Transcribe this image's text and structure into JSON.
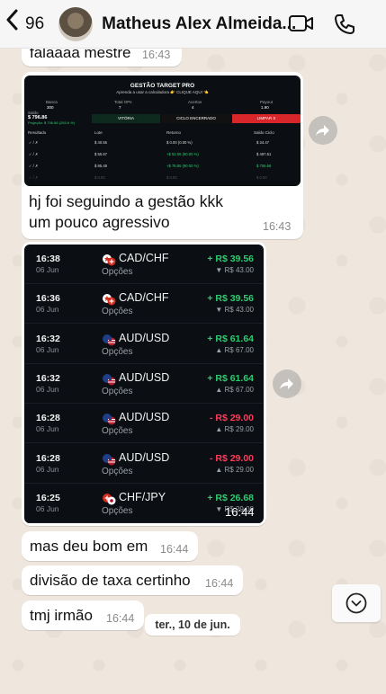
{
  "header": {
    "back_count": "96",
    "contact_name": "Matheus Alex Almeida..."
  },
  "messages": [
    {
      "text": "falaaaa mestre",
      "time": "16:43"
    },
    {
      "caption_line1": "hj foi seguindo a gestão kkk",
      "caption_line2": "um pouco agressivo",
      "time": "16:43"
    },
    {
      "time": "16:44"
    },
    {
      "text": "mas deu bom em",
      "time": "16:44"
    },
    {
      "text": "divisão de taxa certinho",
      "time": "16:44"
    },
    {
      "text": "tmj irmão",
      "time": "16:44"
    }
  ],
  "gestao": {
    "title": "GESTÃO TARGET PRO",
    "subtitle": "Aprenda a usar a calculadora 👉 CLIQUE AQUI 👈",
    "stats_labels": [
      "Banca",
      "Total OPs",
      "Acertos",
      "Payout"
    ],
    "stats_values": [
      "300",
      "7",
      "4",
      "1.90"
    ],
    "balance_label": "Saldo",
    "balance_value": "$ 796.86",
    "projected": "Projeção: $ 796.86 (265.6 %)",
    "tabs": [
      "VITÓRIA",
      "CICLO ENCERRADO",
      "LIMPAR X"
    ],
    "columns": [
      "Resultado",
      "Lote",
      "Retorno",
      "Saldo Ciclo"
    ],
    "rows": [
      [
        "✓ / ✗",
        "$ 40.55",
        "$ 0.00 (0.00 %)",
        "$ 34.47"
      ],
      [
        "✓ / ✗",
        "$ 55.67",
        "+$ 52.06 (90.00 %)",
        "$ 497.61"
      ],
      [
        "✓ / ✗",
        "$ 85.48",
        "+$ 78.85 (90.00 %)",
        "$ 756.66"
      ],
      [
        "✓ / ✗",
        "$ 0.00",
        "$ 0.00",
        "$ 0.00"
      ]
    ]
  },
  "trades": [
    {
      "time": "16:38",
      "date": "06 Jun",
      "pair": "CAD/CHF",
      "type": "Opções",
      "amount": "+ R$ 39.56",
      "stake": "▼ R$ 43.00",
      "color": "#2ecc71",
      "flag": "ca-ch"
    },
    {
      "time": "16:36",
      "date": "06 Jun",
      "pair": "CAD/CHF",
      "type": "Opções",
      "amount": "+ R$ 39.56",
      "stake": "▼ R$ 43.00",
      "color": "#2ecc71",
      "flag": "ca-ch"
    },
    {
      "time": "16:32",
      "date": "06 Jun",
      "pair": "AUD/USD",
      "type": "Opções",
      "amount": "+ R$ 61.64",
      "stake": "▲ R$ 67.00",
      "color": "#2ecc71",
      "flag": "au-us"
    },
    {
      "time": "16:32",
      "date": "06 Jun",
      "pair": "AUD/USD",
      "type": "Opções",
      "amount": "+ R$ 61.64",
      "stake": "▲ R$ 67.00",
      "color": "#2ecc71",
      "flag": "au-us"
    },
    {
      "time": "16:28",
      "date": "06 Jun",
      "pair": "AUD/USD",
      "type": "Opções",
      "amount": "- R$ 29.00",
      "stake": "▲ R$ 29.00",
      "color": "#ff3b5c",
      "flag": "au-us"
    },
    {
      "time": "16:28",
      "date": "06 Jun",
      "pair": "AUD/USD",
      "type": "Opções",
      "amount": "- R$ 29.00",
      "stake": "▲ R$ 29.00",
      "color": "#ff3b5c",
      "flag": "au-us"
    },
    {
      "time": "16:25",
      "date": "06 Jun",
      "pair": "CHF/JPY",
      "type": "Opções",
      "amount": "+ R$ 26.68",
      "stake": "▼ R$ 29.00",
      "color": "#2ecc71",
      "flag": "ch-jp"
    }
  ],
  "date_separator": "ter., 10 de jun.",
  "icons": {
    "back": "chevron-left-icon",
    "video": "video-camera-icon",
    "call": "phone-icon",
    "forward": "forward-arrow-icon",
    "scroll_down": "chevron-down-circle-icon"
  }
}
